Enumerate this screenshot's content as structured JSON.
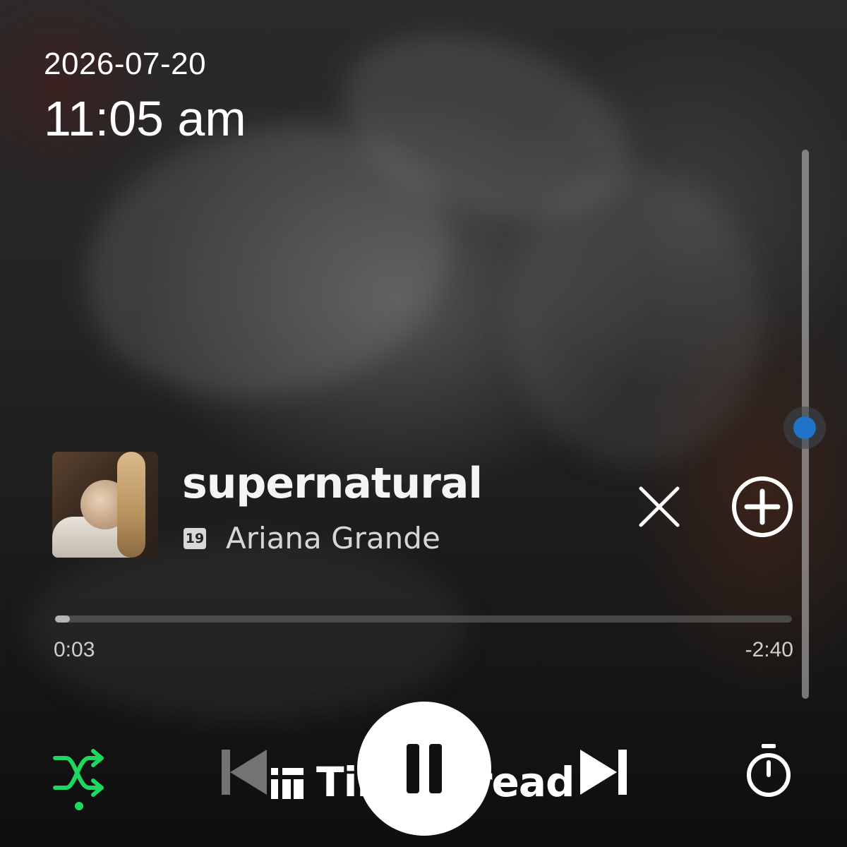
{
  "status": {
    "date": "2026-07-20",
    "time": "11:05 am"
  },
  "now_playing": {
    "title": "supernatural",
    "artist": "Ariana Grande",
    "explicit_badge": "19",
    "elapsed": "0:03",
    "remaining": "-2:40",
    "progress_fraction": 0.02
  },
  "volume": {
    "level_fraction": 0.5
  },
  "controls": {
    "shuffle_active": true,
    "accent_color": "#1ed760",
    "play_state": "playing"
  },
  "icons": {
    "close": "close-icon",
    "add": "plus-circle-icon",
    "shuffle": "shuffle-icon",
    "previous": "skip-previous-icon",
    "pause": "pause-icon",
    "next": "skip-next-icon",
    "timer": "stopwatch-icon"
  },
  "watermark": {
    "text": "TimesTread"
  },
  "colors": {
    "volume_knob": "#1f74c8",
    "text_primary": "#ffffff"
  }
}
